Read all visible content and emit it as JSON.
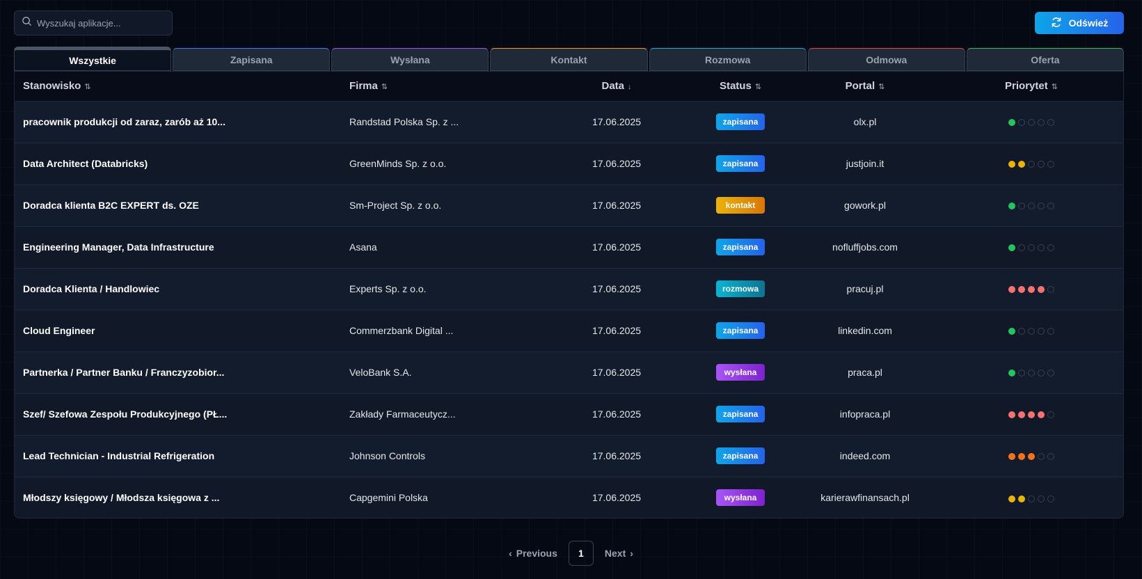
{
  "search": {
    "placeholder": "Wyszukaj aplikacje..."
  },
  "refresh_label": "Odśwież",
  "tabs": [
    {
      "label": "Wszystkie",
      "active": true
    },
    {
      "label": "Zapisana"
    },
    {
      "label": "Wysłana"
    },
    {
      "label": "Kontakt"
    },
    {
      "label": "Rozmowa"
    },
    {
      "label": "Odmowa"
    },
    {
      "label": "Oferta"
    }
  ],
  "table": {
    "headers": {
      "title": "Stanowisko",
      "company": "Firma",
      "date": "Data",
      "status": "Status",
      "portal": "Portal",
      "priority": "Priorytet"
    },
    "rows": [
      {
        "title": "pracownik produkcji od zaraz, zarób aż 10...",
        "company": "Randstad Polska Sp. z ...",
        "date": "17.06.2025",
        "status": "zapisana",
        "portal": "olx.pl",
        "priority": 1
      },
      {
        "title": "Data Architect (Databricks)",
        "company": "GreenMinds Sp. z o.o.",
        "date": "17.06.2025",
        "status": "zapisana",
        "portal": "justjoin.it",
        "priority": 2
      },
      {
        "title": "Doradca klienta B2C EXPERT ds. OZE",
        "company": "Sm-Project Sp. z o.o.",
        "date": "17.06.2025",
        "status": "kontakt",
        "portal": "gowork.pl",
        "priority": 1
      },
      {
        "title": "Engineering Manager, Data Infrastructure",
        "company": "Asana",
        "date": "17.06.2025",
        "status": "zapisana",
        "portal": "nofluffjobs.com",
        "priority": 1
      },
      {
        "title": "Doradca Klienta / Handlowiec",
        "company": "Experts Sp. z o.o.",
        "date": "17.06.2025",
        "status": "rozmowa",
        "portal": "pracuj.pl",
        "priority": 4
      },
      {
        "title": "Cloud Engineer",
        "company": "Commerzbank Digital ...",
        "date": "17.06.2025",
        "status": "zapisana",
        "portal": "linkedin.com",
        "priority": 1
      },
      {
        "title": "Partnerka / Partner Banku / Franczyzobior...",
        "company": "VeloBank S.A.",
        "date": "17.06.2025",
        "status": "wysłana",
        "portal": "praca.pl",
        "priority": 1
      },
      {
        "title": "Szef/ Szefowa Zespołu Produkcyjnego (PŁ...",
        "company": "Zakłady Farmaceutycz...",
        "date": "17.06.2025",
        "status": "zapisana",
        "portal": "infopraca.pl",
        "priority": 4
      },
      {
        "title": "Lead Technician - Industrial Refrigeration",
        "company": "Johnson Controls",
        "date": "17.06.2025",
        "status": "zapisana",
        "portal": "indeed.com",
        "priority": 3
      },
      {
        "title": "Młodszy księgowy / Młodsza księgowa z ...",
        "company": "Capgemini Polska",
        "date": "17.06.2025",
        "status": "wysłana",
        "portal": "karierawfinansach.pl",
        "priority": 2
      }
    ]
  },
  "priority_colors": {
    "1": "#22c55e",
    "2": "#eab308",
    "3": "#f97316",
    "4": "#f87171",
    "5": "#ef4444"
  },
  "pagination": {
    "previous": "Previous",
    "current": "1",
    "next": "Next"
  }
}
